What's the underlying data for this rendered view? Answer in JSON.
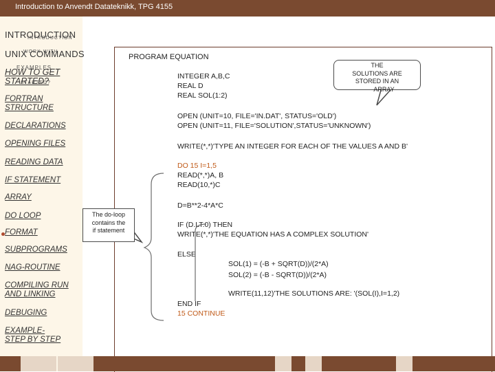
{
  "window": {
    "title": "Introduction to Anvendt Datateknikk, TPG 4155"
  },
  "sidebar": {
    "items": [
      {
        "label": "INTRODUCTION",
        "overlay": "INTRODUCTION"
      },
      {
        "label": "UNIX COMMANDS",
        "overlay": "WORK WITH"
      },
      {
        "label": "EXAMPLES"
      },
      {
        "label": "HOW TO GET STARTED?",
        "overlay": "STARTED?"
      },
      {
        "label": "FORTRAN STRUCTURE"
      },
      {
        "label": "DECLARATIONS"
      },
      {
        "label": "OPENING FILES"
      },
      {
        "label": "READING DATA"
      },
      {
        "label": "IF STATEMENT"
      },
      {
        "label": "ARRAY"
      },
      {
        "label": "DO LOOP"
      },
      {
        "label": "FORMAT"
      },
      {
        "label": "SUBPROGRAMS"
      },
      {
        "label": "NAG-ROUTINE"
      },
      {
        "label": "COMPILING RUN AND LINKING"
      },
      {
        "label": "DEBUGING"
      },
      {
        "label": "EXAMPLE- STEP BY STEP"
      }
    ]
  },
  "code": {
    "program": "PROGRAM EQUATION",
    "decl1": "INTEGER A,B,C",
    "decl2": "REAL D",
    "decl3": "REAL SOL(1:2)",
    "open1": "OPEN (UNIT=10, FILE='IN.DAT', STATUS='OLD')",
    "open2": "OPEN (UNIT=11, FILE='SOLUTION',STATUS='UNKNOWN')",
    "write1": "WRITE(*,*)'TYPE AN INTEGER FOR EACH OF THE VALUES A AND B'",
    "do": "DO 15 I=1,5",
    "read1": "READ(*,*)A, B",
    "read2": "READ(10,*)C",
    "calc": "D=B**2-4*A*C",
    "if": "IF (D.LT.0) THEN",
    "write2": "WRITE(*,*)'THE EQUATION HAS A COMPLEX SOLUTION'",
    "else": "ELSE",
    "sol1": "SOL(1) = (-B + SQRT(D))/(2*A)",
    "sol2": "SOL(2) = (-B - SQRT(D))/(2*A)",
    "write3": "WRITE(11,12)'THE SOLUTIONS ARE: '(SOL(I),I=1,2)",
    "endif": "END IF",
    "continue": "15 CONTINUE"
  },
  "callouts": {
    "solutions": {
      "l1": "THE",
      "l2": "SOLUTIONS ARE",
      "l3": "STORED IN AN",
      "l4": "ARRAY"
    },
    "doloop": {
      "l1": "The do-loop",
      "l2": "contains the",
      "l3": "if statement"
    }
  },
  "colors": {
    "accent": "#7a4a30",
    "highlight": "#c05a18",
    "sidebar_bg": "#fdf6e8"
  }
}
